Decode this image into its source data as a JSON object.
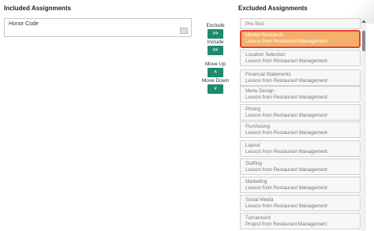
{
  "left_panel": {
    "title": "Included Assignments",
    "items": [
      {
        "label": "Honor Code"
      }
    ]
  },
  "controls": {
    "exclude_label": "Exclude",
    "exclude_btn": ">>",
    "include_label": "Include",
    "include_btn": "<<",
    "move_up_label": "Move Up",
    "move_up_btn": "˄",
    "move_down_label": "Move Down",
    "move_down_btn": "˅"
  },
  "right_panel": {
    "title": "Excluded Assignments",
    "items": [
      {
        "title": "Pre-Test",
        "subtitle": ""
      },
      {
        "title": "Market Research",
        "subtitle": "Lesson from Restaurant Management",
        "selected": true
      },
      {
        "title": "Location Selection",
        "subtitle": "Lesson from Restaurant Management"
      },
      {
        "title": "Financial Statements",
        "subtitle": "Lesson from Restaurant Management"
      },
      {
        "title": "Menu Design",
        "subtitle": "Lesson from Restaurant Management"
      },
      {
        "title": "Pricing",
        "subtitle": "Lesson from Restaurant Management"
      },
      {
        "title": "Purchasing",
        "subtitle": "Lesson from Restaurant Management"
      },
      {
        "title": "Layout",
        "subtitle": "Lesson from Restaurant Management"
      },
      {
        "title": "Staffing",
        "subtitle": "Lesson from Restaurant Management"
      },
      {
        "title": "Marketing",
        "subtitle": "Lesson from Restaurant Management"
      },
      {
        "title": "Social Media",
        "subtitle": "Lesson from Restaurant Management"
      },
      {
        "title": "Turnaround",
        "subtitle": "Project from Restaurant Management"
      }
    ]
  },
  "colors": {
    "button": "#1f8a6e",
    "selected_fill": "#f4b06a",
    "selected_border": "#e0443a"
  }
}
